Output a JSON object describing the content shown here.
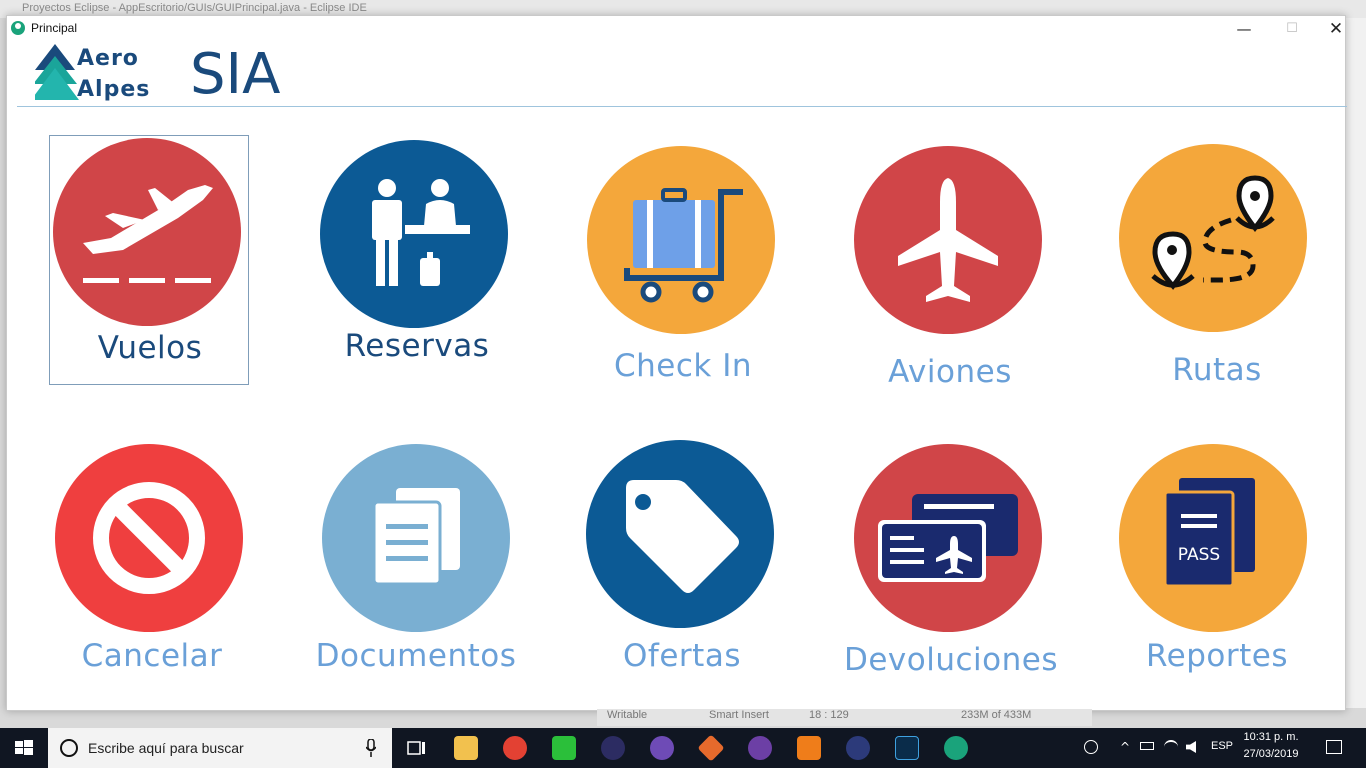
{
  "background_window": {
    "title": "Proyectos Eclipse - AppEscritorio/GUIs/GUIPrincipal.java - Eclipse IDE"
  },
  "window": {
    "title": "Principal",
    "controls": {
      "minimize": "—",
      "maximize": "☐",
      "close": "✕"
    }
  },
  "header": {
    "logo_line1": "Aero",
    "logo_line2": "Alpes",
    "app_title": "SIA"
  },
  "tiles": [
    {
      "label": "Vuelos",
      "icon": "plane-takeoff-icon",
      "color": "#d04548",
      "selected": true
    },
    {
      "label": "Reservas",
      "icon": "reception-desk-icon",
      "color": "#0c5a95"
    },
    {
      "label": "Check In",
      "icon": "luggage-cart-icon",
      "color": "#f4a73b"
    },
    {
      "label": "Aviones",
      "icon": "airplane-icon",
      "color": "#d04548"
    },
    {
      "label": "Rutas",
      "icon": "route-pins-icon",
      "color": "#f4a73b"
    },
    {
      "label": "Cancelar",
      "icon": "prohibited-icon",
      "color": "#ef3f3f"
    },
    {
      "label": "Documentos",
      "icon": "documents-icon",
      "color": "#7aafd2"
    },
    {
      "label": "Ofertas",
      "icon": "price-tag-icon",
      "color": "#0c5a95"
    },
    {
      "label": "Devoluciones",
      "icon": "tickets-icon",
      "color": "#d04548"
    },
    {
      "label": "Reportes",
      "icon": "passport-icon",
      "color": "#f4a73b",
      "pass_text": "PASS"
    }
  ],
  "status_strip": {
    "writable": "Writable",
    "insert": "Smart Insert",
    "position": "18 : 129",
    "memory": "233M of 433M"
  },
  "taskbar": {
    "search_placeholder": "Escribe aquí para buscar",
    "language": "ESP",
    "time": "10:31 p. m.",
    "date": "27/03/2019"
  }
}
